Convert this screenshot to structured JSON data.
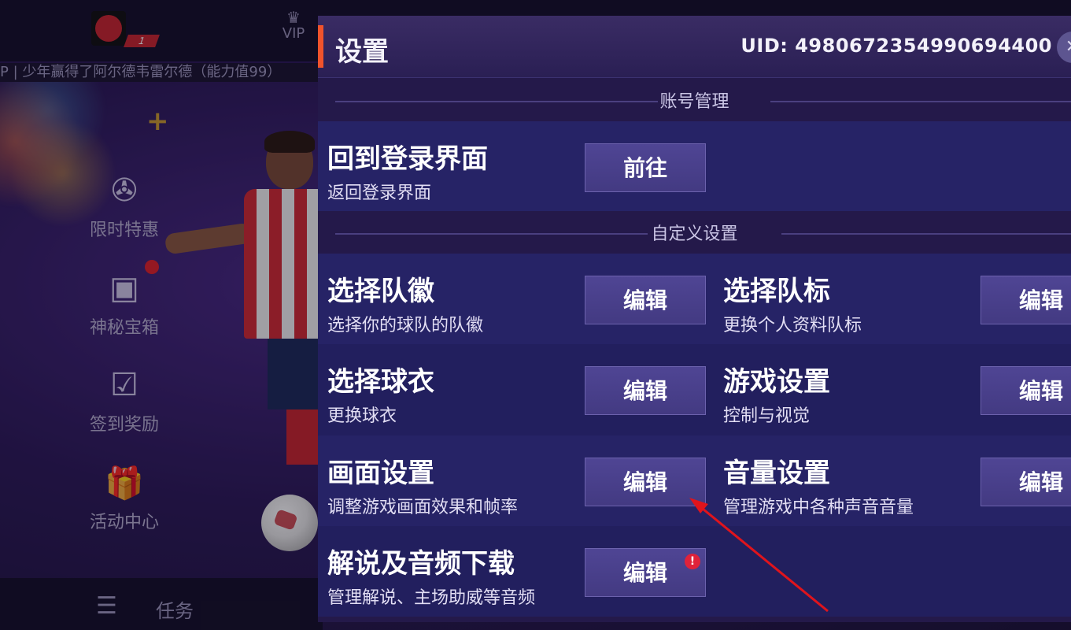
{
  "background": {
    "vip_label": "VIP",
    "level": "1",
    "ticker": "P | 少年赢得了阿尔德韦雷尔德（能力值99）",
    "side_menu": [
      {
        "label": "限时特惠",
        "icon": "wheel-icon"
      },
      {
        "label": "神秘宝箱",
        "icon": "chest-icon"
      },
      {
        "label": "签到奖励",
        "icon": "calendar-check-icon"
      },
      {
        "label": "活动中心",
        "icon": "gift-fifa-icon"
      }
    ],
    "task_label": "任务"
  },
  "settings": {
    "title": "设置",
    "uid": "UID: 4980672354990694400",
    "sections": {
      "account": "账号管理",
      "custom": "自定义设置"
    },
    "login": {
      "title": "回到登录界面",
      "subtitle": "返回登录界面",
      "button": "前往"
    },
    "options": [
      {
        "title": "选择队徽",
        "subtitle": "选择你的球队的队徽",
        "button": "编辑"
      },
      {
        "title": "选择队标",
        "subtitle": "更换个人资料队标",
        "button": "编辑"
      },
      {
        "title": "选择球衣",
        "subtitle": "更换球衣",
        "button": "编辑"
      },
      {
        "title": "游戏设置",
        "subtitle": "控制与视觉",
        "button": "编辑"
      },
      {
        "title": "画面设置",
        "subtitle": "调整游戏画面效果和帧率",
        "button": "编辑"
      },
      {
        "title": "音量设置",
        "subtitle": "管理游戏中各种声音音量",
        "button": "编辑"
      },
      {
        "title": "解说及音频下载",
        "subtitle": "管理解说、主场助威等音频",
        "button": "编辑",
        "alert": "!"
      }
    ]
  },
  "colors": {
    "accent": "#f0532c",
    "panel": "#24194a",
    "button": "#4a4090",
    "annotation_arrow": "#e0141c"
  }
}
